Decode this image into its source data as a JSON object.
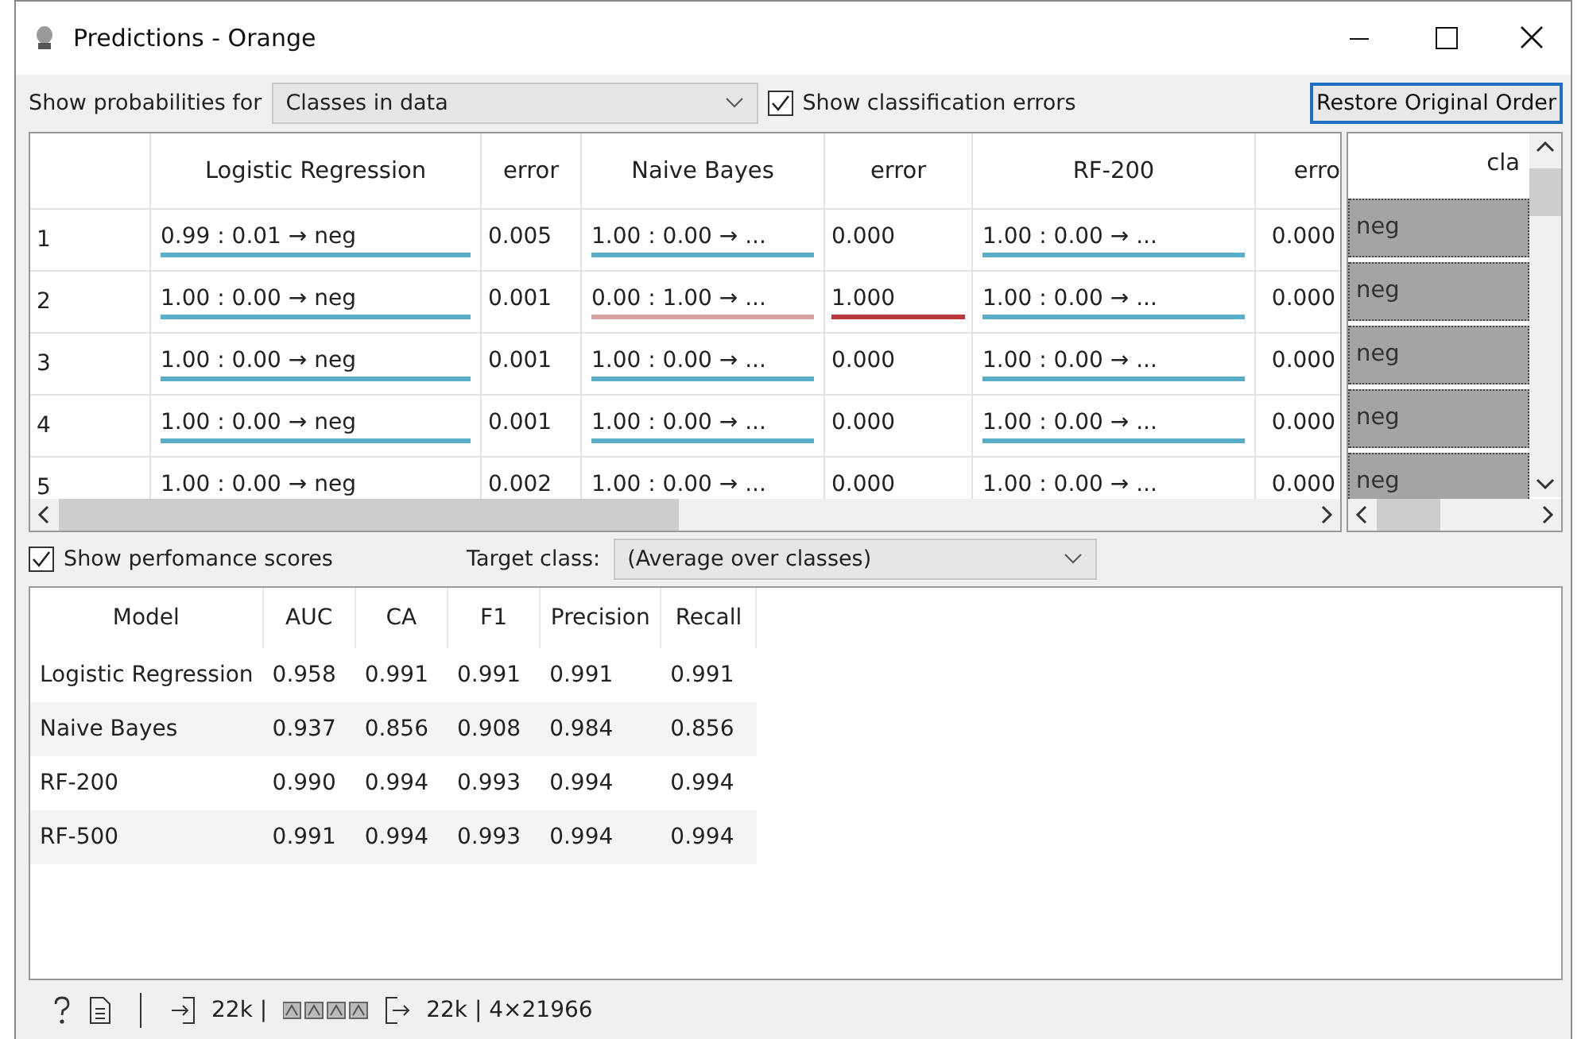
{
  "window": {
    "title": "Predictions - Orange"
  },
  "controls": {
    "probabilities_label": "Show probabilities for",
    "probabilities_value": "Classes in data",
    "show_errors": {
      "label": "Show classification errors",
      "checked": true
    },
    "restore_button": "Restore Original Order"
  },
  "predictions": {
    "columns": [
      {
        "label": "Logistic Regression",
        "kind": "prediction"
      },
      {
        "label": "error",
        "kind": "error"
      },
      {
        "label": "Naive Bayes",
        "kind": "prediction"
      },
      {
        "label": "error",
        "kind": "error"
      },
      {
        "label": "RF-200",
        "kind": "prediction"
      },
      {
        "label": "erro",
        "kind": "error"
      }
    ],
    "rows": [
      {
        "index": "1",
        "cells": [
          {
            "text": "0.99 : 0.01 → neg",
            "color": "#5aafc8"
          },
          {
            "text": "0.005"
          },
          {
            "text": "1.00 : 0.00 → ...",
            "color": "#5aafc8"
          },
          {
            "text": "0.000"
          },
          {
            "text": "1.00 : 0.00 → ...",
            "color": "#5aafc8"
          },
          {
            "text": "0.000"
          }
        ]
      },
      {
        "index": "2",
        "cells": [
          {
            "text": "1.00 : 0.00 → neg",
            "color": "#5aafc8"
          },
          {
            "text": "0.001"
          },
          {
            "text": "0.00 : 1.00 → ...",
            "color": "#d9a0a4"
          },
          {
            "text": "1.000",
            "color": "#b83a3e"
          },
          {
            "text": "1.00 : 0.00 → ...",
            "color": "#5aafc8"
          },
          {
            "text": "0.000"
          }
        ]
      },
      {
        "index": "3",
        "cells": [
          {
            "text": "1.00 : 0.00 → neg",
            "color": "#5aafc8"
          },
          {
            "text": "0.001"
          },
          {
            "text": "1.00 : 0.00 → ...",
            "color": "#5aafc8"
          },
          {
            "text": "0.000"
          },
          {
            "text": "1.00 : 0.00 → ...",
            "color": "#5aafc8"
          },
          {
            "text": "0.000"
          }
        ]
      },
      {
        "index": "4",
        "cells": [
          {
            "text": "1.00 : 0.00 → neg",
            "color": "#5aafc8"
          },
          {
            "text": "0.001"
          },
          {
            "text": "1.00 : 0.00 → ...",
            "color": "#5aafc8"
          },
          {
            "text": "0.000"
          },
          {
            "text": "1.00 : 0.00 → ...",
            "color": "#5aafc8"
          },
          {
            "text": "0.000"
          }
        ]
      },
      {
        "index": "5",
        "cells": [
          {
            "text": "1.00 : 0.00 → neg"
          },
          {
            "text": "0.002"
          },
          {
            "text": "1.00 : 0.00 → ..."
          },
          {
            "text": "0.000"
          },
          {
            "text": "1.00 : 0.00 → ..."
          },
          {
            "text": "0.000"
          }
        ]
      }
    ]
  },
  "class_table": {
    "header": "cla",
    "values": [
      "neg",
      "neg",
      "neg",
      "neg",
      "neg"
    ]
  },
  "scores_controls": {
    "show_scores": {
      "label": "Show perfomance scores",
      "checked": true
    },
    "target_label": "Target class:",
    "target_value": "(Average over classes)"
  },
  "scores": {
    "columns": [
      "Model",
      "AUC",
      "CA",
      "F1",
      "Precision",
      "Recall"
    ],
    "rows": [
      [
        "Logistic Regression",
        "0.958",
        "0.991",
        "0.991",
        "0.991",
        "0.991"
      ],
      [
        "Naive Bayes",
        "0.937",
        "0.856",
        "0.908",
        "0.984",
        "0.856"
      ],
      [
        "RF-200",
        "0.990",
        "0.994",
        "0.993",
        "0.994",
        "0.994"
      ],
      [
        "RF-500",
        "0.991",
        "0.994",
        "0.993",
        "0.994",
        "0.994"
      ]
    ]
  },
  "status_bar": {
    "input": "22k |",
    "output": "22k | 4×21966"
  }
}
